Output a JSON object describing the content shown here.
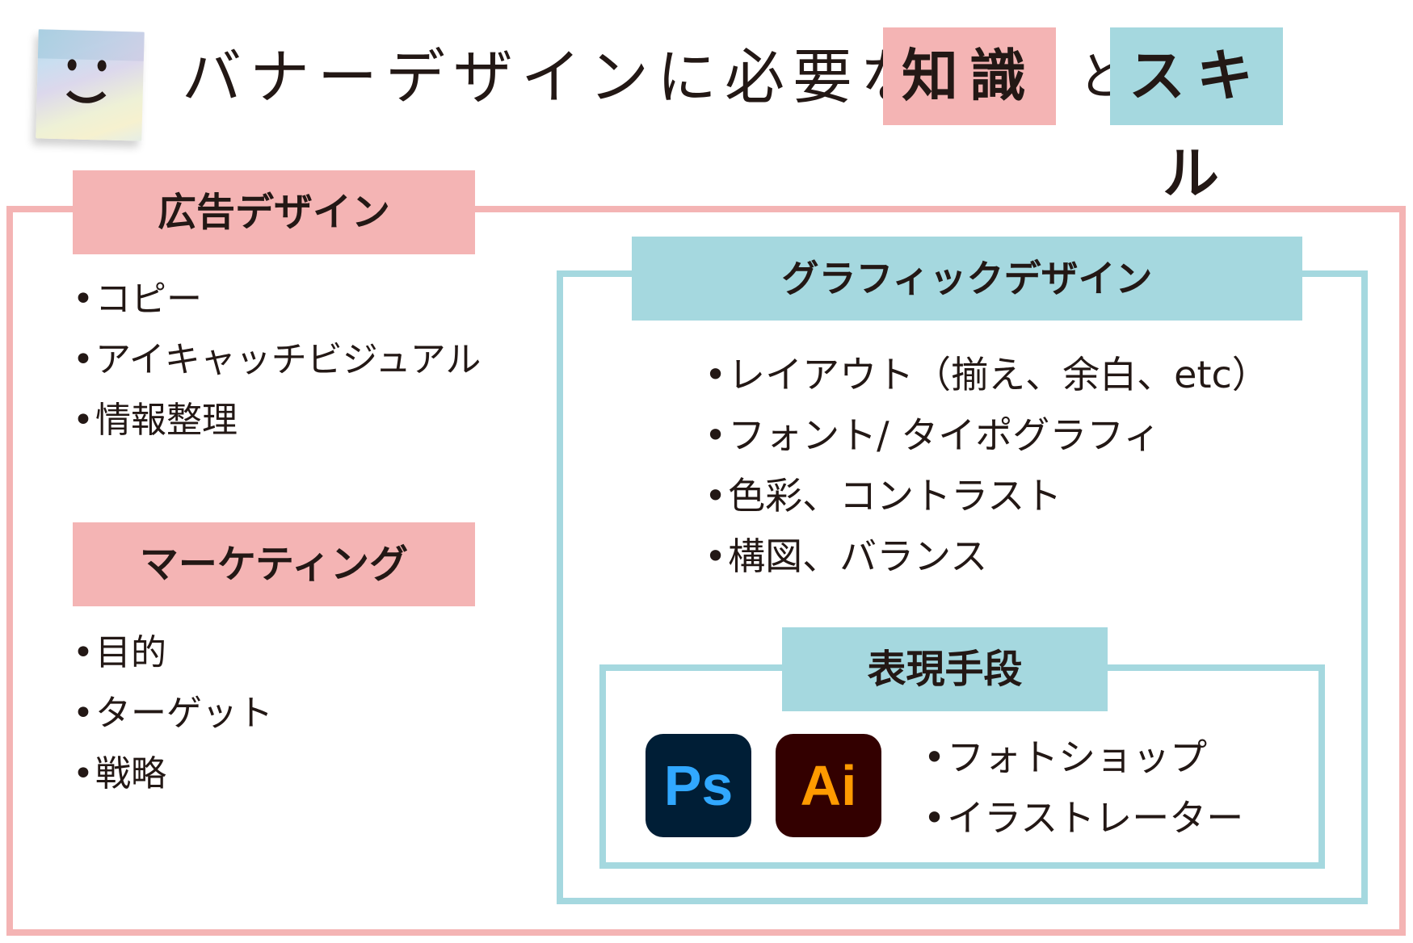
{
  "title": {
    "main": "バナーデザインに必要な",
    "tag_knowledge": "知識",
    "connector": "と",
    "tag_skill": "スキル",
    "icon": "smiley-sticky-note-icon"
  },
  "colors": {
    "pink": "#f4b4b4",
    "teal": "#a5d8df",
    "text": "#231815",
    "photoshop_bg": "#001e36",
    "photoshop_fg": "#31a8ff",
    "illustrator_bg": "#330000",
    "illustrator_fg": "#ff9a00"
  },
  "sections": {
    "ad_design": {
      "label": "広告デザイン",
      "items": [
        "コピー",
        "アイキャッチビジュアル",
        "情報整理"
      ]
    },
    "marketing": {
      "label": "マーケティング",
      "items": [
        "目的",
        "ターゲット",
        "戦略"
      ]
    },
    "graphic_design": {
      "label": "グラフィックデザイン",
      "items": [
        "レイアウト（揃え、余白、etc）",
        "フォント/ タイポグラフィ",
        "色彩、コントラスト",
        "構図、バランス"
      ]
    },
    "expression": {
      "label": "表現手段",
      "apps": [
        {
          "name": "photoshop-icon",
          "text": "Ps"
        },
        {
          "name": "illustrator-icon",
          "text": "Ai"
        }
      ],
      "items": [
        "フォトショップ",
        "イラストレーター"
      ]
    }
  }
}
